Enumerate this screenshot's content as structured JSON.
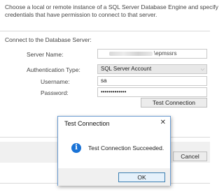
{
  "intro": {
    "line1": "Choose a local or remote instance of a SQL Server Database Engine and specify",
    "line2": "credentials that have permission to connect to that server."
  },
  "section": {
    "label": "Connect to the Database Server:"
  },
  "form": {
    "server_name_label": "Server Name:",
    "server_name_suffix": "\\epmssrs",
    "auth_type_label": "Authentication Type:",
    "auth_type_value": "SQL Server Account",
    "username_label": "Username:",
    "username_value": "sa",
    "password_label": "Password:",
    "password_value": "•••••••••••••",
    "test_button": "Test Connection"
  },
  "footer": {
    "cancel_button": "Cancel"
  },
  "dialog": {
    "title": "Test Connection",
    "close": "✕",
    "info_icon": "i",
    "message": "Test Connection Succeeded.",
    "ok_button": "OK"
  }
}
